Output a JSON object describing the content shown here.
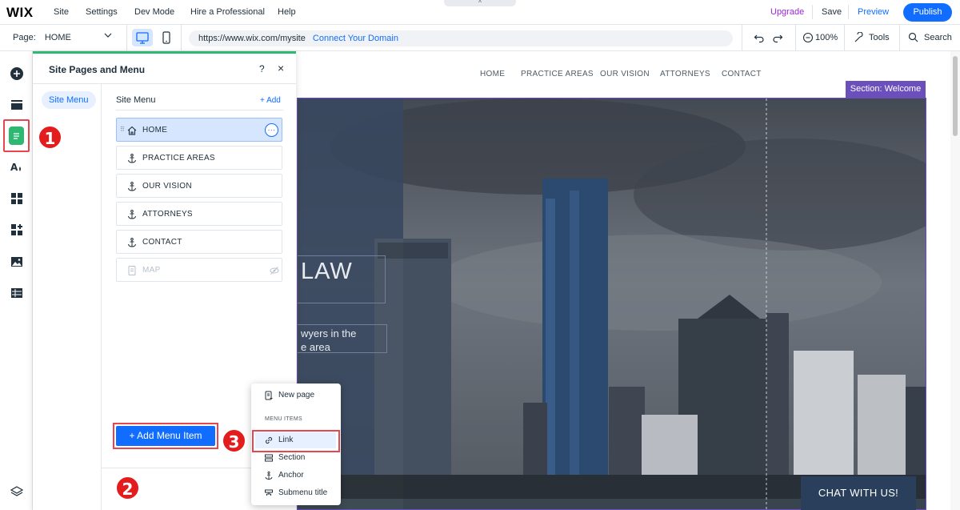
{
  "topbar": {
    "logo": "WIX",
    "menu": [
      "Site",
      "Settings",
      "Dev Mode",
      "Hire a Professional",
      "Help"
    ],
    "collapse_glyph": "^",
    "upgrade": "Upgrade",
    "save": "Save",
    "preview": "Preview",
    "publish": "Publish"
  },
  "secondbar": {
    "page_label": "Page:",
    "page_value": "HOME",
    "url": "https://www.wix.com/mysite",
    "connect_domain": "Connect Your Domain",
    "zoom": "100%",
    "tools": "Tools",
    "search": "Search"
  },
  "leftrail": {
    "icons": [
      "add-icon",
      "menus-icon",
      "pages-icon",
      "design-icon",
      "apps-icon",
      "business-icon",
      "media-icon",
      "cms-icon",
      "layers-icon"
    ]
  },
  "site": {
    "nav": [
      "HOME",
      "PRACTICE AREAS",
      "OUR VISION",
      "ATTORNEYS",
      "CONTACT"
    ],
    "section_tag": "Section: Welcome",
    "hero_heading_fragment": "LAW",
    "hero_sub_line1": "wyers in the",
    "hero_sub_line2": "e area",
    "chat_button": "CHAT WITH US!"
  },
  "panel": {
    "title": "Site Pages and Menu",
    "help": "?",
    "close": "×",
    "side_tab": "Site Menu",
    "menu_label": "Site Menu",
    "add_link": "+ Add",
    "items": [
      {
        "label": "HOME",
        "icon": "home-icon",
        "state": "selected"
      },
      {
        "label": "PRACTICE AREAS",
        "icon": "anchor-icon",
        "state": "normal"
      },
      {
        "label": "OUR VISION",
        "icon": "anchor-icon",
        "state": "normal"
      },
      {
        "label": "ATTORNEYS",
        "icon": "anchor-icon",
        "state": "normal"
      },
      {
        "label": "CONTACT",
        "icon": "anchor-icon",
        "state": "normal"
      },
      {
        "label": "MAP",
        "icon": "page-icon",
        "state": "hidden"
      }
    ],
    "add_menu_item": "+ Add Menu Item"
  },
  "dropdown": {
    "new_page": "New page",
    "section_header": "MENU ITEMS",
    "link": "Link",
    "section": "Section",
    "anchor": "Anchor",
    "submenu_title": "Submenu title"
  },
  "annotations": {
    "step1": "1",
    "step2": "2",
    "step3": "3",
    "color": "#e31d1d"
  },
  "colors": {
    "accent": "#116dff",
    "panel_accent": "#2eb872",
    "section_purple": "#6b4fbb",
    "highlight_red": "#e8464f"
  }
}
